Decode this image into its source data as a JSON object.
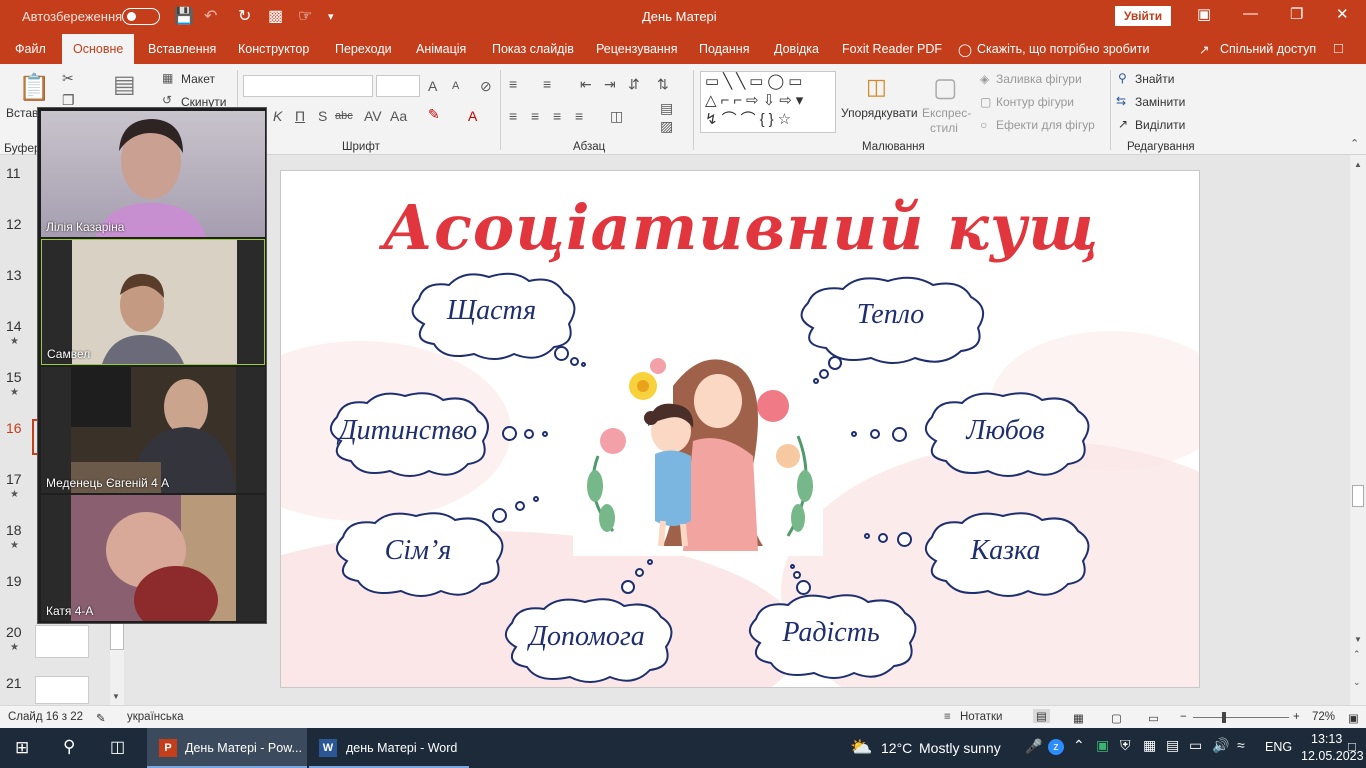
{
  "titlebar": {
    "autosave_label": "Автозбереження",
    "doc_title": "День Матері",
    "signin_label": "Увійти"
  },
  "tabs": [
    "Файл",
    "Основне",
    "Вставлення",
    "Конструктор",
    "Переходи",
    "Анімація",
    "Показ слайдів",
    "Рецензування",
    "Подання",
    "Довідка",
    "Foxit Reader PDF"
  ],
  "active_tab": "Основне",
  "tell_me": "Скажіть, що потрібно зробити",
  "share_label": "Спільний доступ",
  "ribbon": {
    "paste_label": "Встав",
    "clipboard_label": "Буфер",
    "layout_label": "Макет",
    "reset_label": "Скинути",
    "font_group": "Шрифт",
    "paragraph_group": "Абзац",
    "drawing_group": "Малювання",
    "editing_group": "Редагування",
    "arrange_label": "Упорядкувати",
    "quick_styles_label1": "Експрес-",
    "quick_styles_label2": "стилі",
    "shape_fill": "Заливка фігури",
    "shape_outline": "Контур фігури",
    "shape_effects": "Ефекти для фігур",
    "find": "Знайти",
    "replace": "Замінити",
    "select": "Виділити"
  },
  "slide_numbers": [
    "11",
    "12",
    "13",
    "14",
    "15",
    "16",
    "17",
    "18",
    "19",
    "20",
    "21"
  ],
  "current_slide": "16",
  "slide": {
    "title": "Асоціативний кущ",
    "clouds": [
      "Щастя",
      "Тепло",
      "Дитинство",
      "Любов",
      "Сім’я",
      "Казка",
      "Допомога",
      "Радість"
    ]
  },
  "video": {
    "participants": [
      "Лілія Казаріна",
      "Самвел",
      "Меденець Євгеній 4 А",
      "Катя  4-А"
    ]
  },
  "status": {
    "slide_info": "Слайд 16 з 22",
    "language": "українська",
    "notes_label": "Нотатки",
    "zoom": "72%"
  },
  "taskbar": {
    "apps": [
      "День Матері - Pow...",
      "день Матері - Word"
    ],
    "weather_temp": "12°C",
    "weather_desc": "Mostly sunny",
    "lang": "ENG",
    "time": "13:13",
    "date": "12.05.2023"
  },
  "colors": {
    "accent": "#c43e1c",
    "title_red": "#e2363e",
    "cloud_text": "#1e2e6e",
    "taskbar": "#1c2a3a"
  }
}
